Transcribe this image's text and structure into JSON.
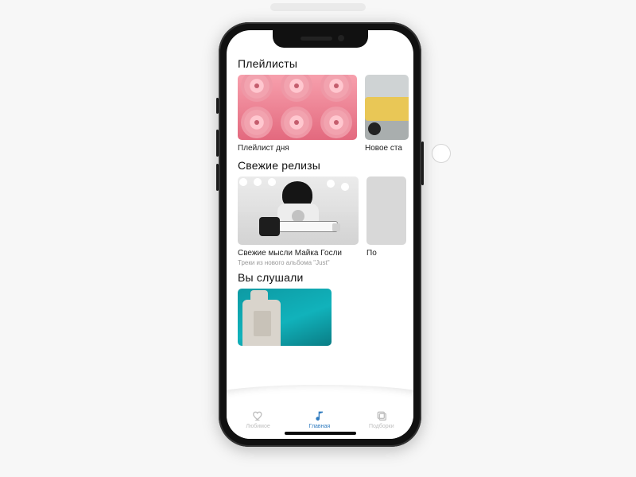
{
  "sections": {
    "playlists": {
      "title": "Плейлисты",
      "items": [
        {
          "label": "Плейлист дня"
        },
        {
          "label": "Новое ста"
        }
      ]
    },
    "fresh": {
      "title": "Свежие релизы",
      "items": [
        {
          "label": "Свежие мысли Майка Госли",
          "sub": "Треки из нового альбома \"Just\""
        },
        {
          "label": "По",
          "sub": ""
        }
      ]
    },
    "listened": {
      "title": "Вы слушали"
    }
  },
  "tabs": {
    "favorites": "Любимое",
    "home": "Главная",
    "collections": "Подборки"
  }
}
